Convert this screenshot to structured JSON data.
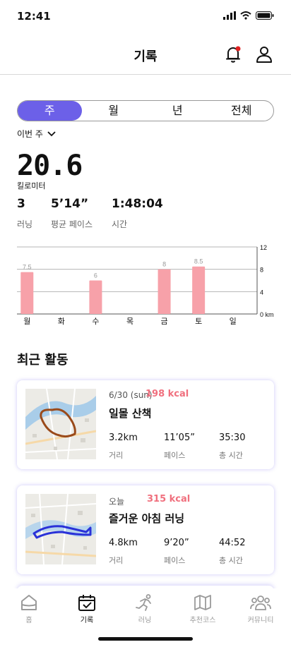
{
  "status_bar": {
    "time": "12:41"
  },
  "header": {
    "title": "기록"
  },
  "period_tabs": [
    {
      "label": "주",
      "active": true
    },
    {
      "label": "월",
      "active": false
    },
    {
      "label": "년",
      "active": false
    },
    {
      "label": "전체",
      "active": false
    }
  ],
  "range_select": {
    "value": "이번 주"
  },
  "summary": {
    "distance": "20.6",
    "distance_unit": "킬로미터",
    "stats": [
      {
        "value": "3",
        "label": "러닝"
      },
      {
        "value": "5’14”",
        "label": "평균 페이스"
      },
      {
        "value": "1:48:04",
        "label": "시간"
      }
    ]
  },
  "chart_data": {
    "type": "bar",
    "categories": [
      "월",
      "화",
      "수",
      "목",
      "금",
      "토",
      "일"
    ],
    "values": [
      7.5,
      0,
      6,
      0,
      8,
      8.5,
      0
    ],
    "data_labels": [
      "7.5",
      "",
      "6",
      "",
      "8",
      "8.5",
      ""
    ],
    "y_ticks": [
      "12",
      "8",
      "4",
      "0 km"
    ],
    "ylim": [
      0,
      12
    ],
    "bar_color": "#f7a1a9",
    "grid": true
  },
  "recent": {
    "title": "최근 활동",
    "activities": [
      {
        "date": "6/30 (sun)",
        "kcal": "198 kcal",
        "title": "일몰 산책",
        "route_color": "#9a4a1a",
        "stats": [
          {
            "value": "3.2km",
            "label": "거리"
          },
          {
            "value": "11’05”",
            "label": "페이스"
          },
          {
            "value": "35:30",
            "label": "총 시간"
          }
        ]
      },
      {
        "date": "오늘",
        "kcal": "315 kcal",
        "title": "즐거운 아침 러닝",
        "route_color": "#2a32d8",
        "stats": [
          {
            "value": "4.8km",
            "label": "거리"
          },
          {
            "value": "9’20”",
            "label": "페이스"
          },
          {
            "value": "44:52",
            "label": "총 시간"
          }
        ]
      }
    ]
  },
  "nav": [
    {
      "label": "홈",
      "icon": "home-icon",
      "active": false
    },
    {
      "label": "기록",
      "icon": "calendar-icon",
      "active": true
    },
    {
      "label": "러닝",
      "icon": "runner-icon",
      "active": false
    },
    {
      "label": "추천코스",
      "icon": "map-icon",
      "active": false
    },
    {
      "label": "커뮤니티",
      "icon": "people-icon",
      "active": false
    }
  ],
  "colors": {
    "accent": "#6c60e8",
    "kcal": "#f0707e",
    "notification_dot": "#e02020"
  }
}
